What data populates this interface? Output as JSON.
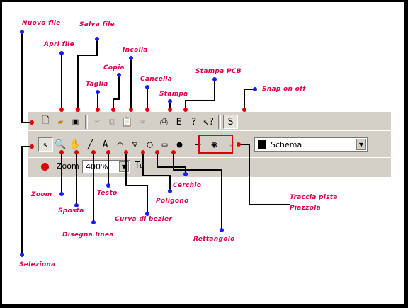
{
  "callouts": {
    "nuovo_file": "Nuovo file",
    "apri_file": "Apri file",
    "salva_file": "Salva file",
    "taglia": "Taglia",
    "copia": "Copia",
    "incolla": "Incolla",
    "cancella": "Cancella",
    "stampa": "Stampa",
    "stampa_pcb": "Stampa PCB",
    "snap": "Snap on off",
    "zoom": "Zoom",
    "sposta": "Sposta",
    "disegna_linea": "Disegna linea",
    "testo": "Testo",
    "curva_di_bezier": "Curva di bezier",
    "poligono": "Poligono",
    "cerchio": "Cerchio",
    "rettangolo": "Rettangolo",
    "traccia_pista": "Traccia pista",
    "piazzola": "Piazzola",
    "seleziona": "Seleziona"
  },
  "toolbar": {
    "snap_label": "S",
    "layer_value": "Schema",
    "zoom_label": "Zoom",
    "zoom_value": "400%",
    "text_tool_label": "T",
    "text_tool_sub": "L"
  },
  "colors": {
    "callout_text": "#e0004a",
    "marker_dot": "#1a1aff",
    "leader_line": "#000000",
    "highlight_box": "#e00000",
    "toolbar_bg": "#d4d0c8"
  }
}
